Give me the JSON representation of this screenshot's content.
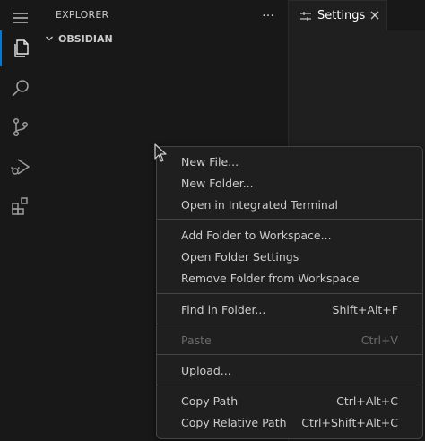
{
  "sidebar": {
    "title": "EXPLORER",
    "more": "…",
    "section": "OBSIDIAN"
  },
  "activity_bar": {
    "items": [
      "menu-icon",
      "explorer-icon",
      "search-icon",
      "source-control-icon",
      "run-debug-icon",
      "extensions-icon"
    ],
    "active": "explorer-icon",
    "accent": "#0078d4"
  },
  "tab": {
    "label": "Settings",
    "icon": "settings-sliders-icon"
  },
  "menu": {
    "items": [
      {
        "label": "New File...",
        "shortcut": ""
      },
      {
        "label": "New Folder...",
        "shortcut": ""
      },
      {
        "label": "Open in Integrated Terminal",
        "shortcut": ""
      },
      {
        "label": "Add Folder to Workspace...",
        "shortcut": ""
      },
      {
        "label": "Open Folder Settings",
        "shortcut": ""
      },
      {
        "label": "Remove Folder from Workspace",
        "shortcut": ""
      },
      {
        "label": "Find in Folder...",
        "shortcut": "Shift+Alt+F"
      },
      {
        "label": "Paste",
        "shortcut": "Ctrl+V",
        "disabled": true
      },
      {
        "label": "Upload...",
        "shortcut": ""
      },
      {
        "label": "Copy Path",
        "shortcut": "Ctrl+Alt+C"
      },
      {
        "label": "Copy Relative Path",
        "shortcut": "Ctrl+Shift+Alt+C"
      }
    ]
  }
}
